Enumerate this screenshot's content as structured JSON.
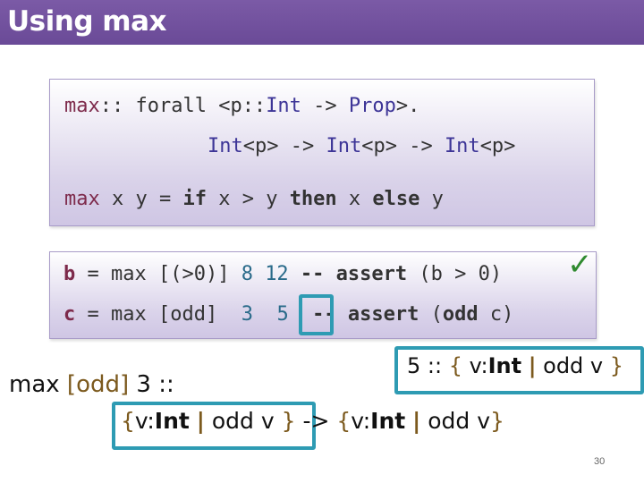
{
  "slide": {
    "title": "Using max",
    "page_number": "30"
  },
  "code_box1": {
    "line1": [
      "max",
      ":: forall <p::",
      "Int",
      " -> ",
      "Prop",
      ">."
    ],
    "line2": [
      "Int",
      "<p> -> ",
      "Int",
      "<p> -> ",
      "Int",
      "<p>"
    ],
    "line3": [
      "max",
      " x y = ",
      "if",
      " x > y ",
      "then",
      " x ",
      "else",
      " y"
    ]
  },
  "code_box2": {
    "line1": [
      "b",
      " = max [(>0)] ",
      "8",
      " ",
      "12",
      " -- ",
      "assert",
      " (b > 0)"
    ],
    "line2": [
      "c",
      " = max [odd]  ",
      "3",
      "  ",
      "5",
      "  -- ",
      "assert",
      " (",
      "odd",
      " c)"
    ]
  },
  "annotations": {
    "check": "✓",
    "max_expr": [
      "max ",
      "[odd]",
      " 3 ::"
    ],
    "five_type": [
      "5 :: ",
      "{",
      " v:",
      "Int",
      " ",
      "|",
      " odd v ",
      "}"
    ],
    "arrow_type": [
      "{",
      "v:",
      "Int",
      " ",
      "|",
      " odd v ",
      "}",
      " -> ",
      "{",
      "v:",
      "Int",
      " ",
      "|",
      " odd v",
      "}"
    ]
  }
}
